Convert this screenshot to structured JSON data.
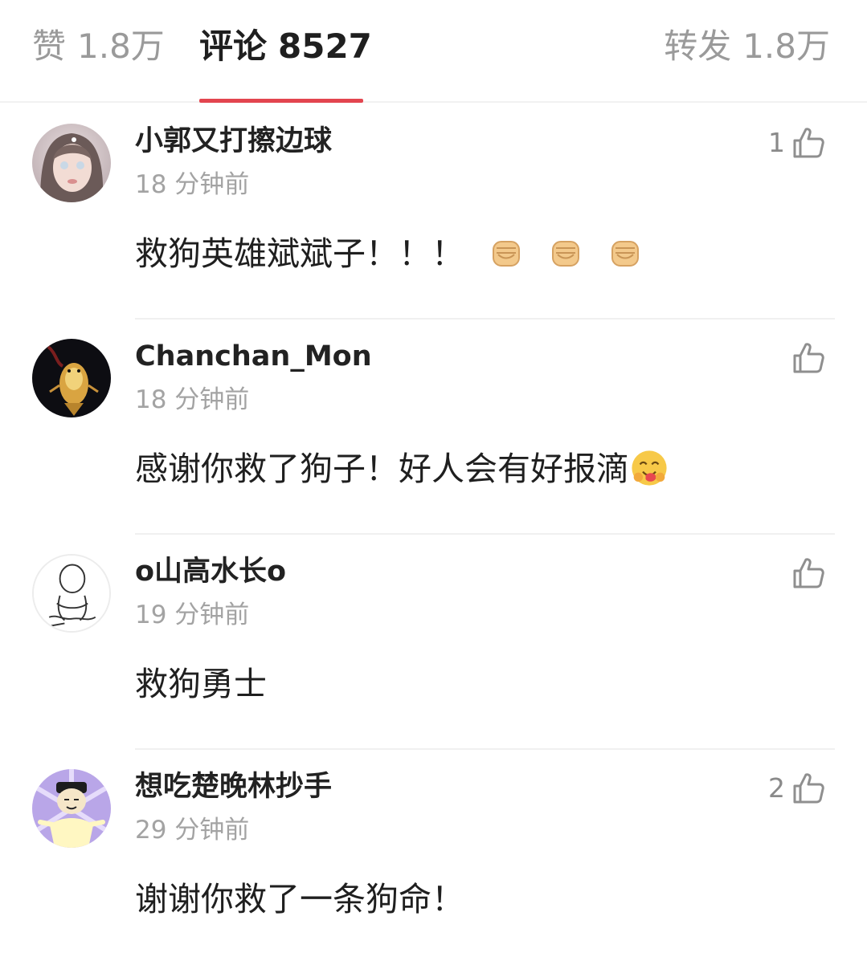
{
  "tabs": {
    "likes": {
      "label": "赞",
      "count": "1.8万"
    },
    "comments": {
      "label": "评论",
      "count": "8527"
    },
    "reposts": {
      "label": "转发",
      "count": "1.8万"
    }
  },
  "colors": {
    "active_tab_underline": "#e3454f",
    "muted_text": "#a3a3a3"
  },
  "comments": [
    {
      "username": "小郭又打擦边球",
      "time": "18 分钟前",
      "text": "救狗英雄斌斌子！！！",
      "emojis": [
        "fist-emoji",
        "fist-emoji",
        "fist-emoji"
      ],
      "likes": "1",
      "avatar": "girl-photo-avatar"
    },
    {
      "username": "Chanchan_Mon",
      "time": "18 分钟前",
      "text": "感谢你救了狗子！好人会有好报滴",
      "emojis": [
        "hugging-face-emoji"
      ],
      "likes": "",
      "avatar": "koi-fish-avatar"
    },
    {
      "username": "o山高水长o",
      "time": "19 分钟前",
      "text": "救狗勇士",
      "emojis": [],
      "likes": "",
      "avatar": "sketch-person-avatar"
    },
    {
      "username": "想吃楚晚林抄手",
      "time": "29 分钟前",
      "text": "谢谢你救了一条狗命！",
      "emojis": [],
      "likes": "2",
      "avatar": "cartoon-meme-avatar"
    }
  ]
}
